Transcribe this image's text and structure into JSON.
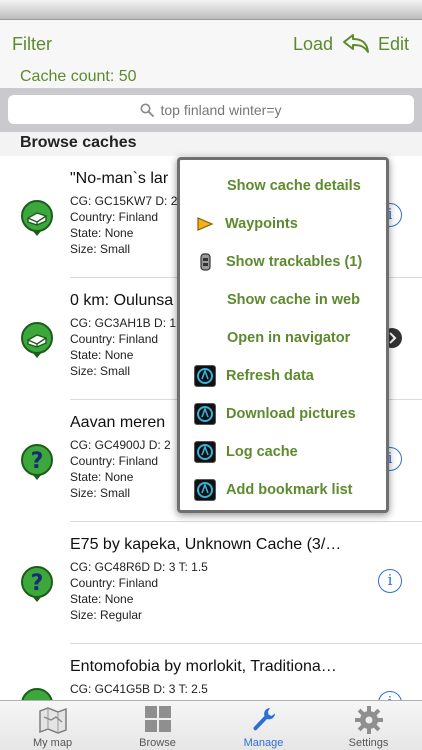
{
  "nav": {
    "filter": "Filter",
    "load": "Load",
    "edit": "Edit",
    "cache_count": "Cache count: 50"
  },
  "search": {
    "value": "top finland winter=y"
  },
  "section": {
    "title": "Browse caches"
  },
  "caches": [
    {
      "title": "\"No-man`s lar",
      "cg": "CG: GC15KW7 D: 2",
      "country": "Country: Finland",
      "state": "State: None",
      "size": "Size: Small",
      "icon": "traditional-cache-icon",
      "accessory": "info"
    },
    {
      "title": "0 km: Oulunsa",
      "cg": "CG: GC3AH1B D: 1",
      "country": "Country: Finland",
      "state": "State: None",
      "size": "Size: Small",
      "icon": "traditional-cache-icon",
      "accessory": "disclosure"
    },
    {
      "title": "Aavan meren",
      "cg": "CG: GC4900J D: 2",
      "country": "Country: Finland",
      "state": "State: None",
      "size": "Size: Small",
      "icon": "unknown-cache-icon",
      "accessory": "info"
    },
    {
      "title": "E75 by kapeka, Unknown Cache (3/…",
      "cg": "CG: GC48R6D D: 3 T: 1.5",
      "country": "Country: Finland",
      "state": "State: None",
      "size": "Size: Regular",
      "icon": "unknown-cache-icon",
      "accessory": "info"
    },
    {
      "title": "Entomofobia by morlokit, Traditiona…",
      "cg": "CG: GC41G5B D: 3 T: 2.5",
      "country": "",
      "state": "",
      "size": "",
      "icon": "traditional-cache-icon",
      "accessory": "info"
    }
  ],
  "menu": [
    {
      "label": "Show cache details",
      "icon": ""
    },
    {
      "label": "Waypoints",
      "icon": "flag-icon"
    },
    {
      "label": "Show trackables (1)",
      "icon": "trackable-icon"
    },
    {
      "label": "Show cache in web",
      "icon": ""
    },
    {
      "label": "Open in navigator",
      "icon": ""
    },
    {
      "label": "Refresh data",
      "icon": "app-icon"
    },
    {
      "label": "Download pictures",
      "icon": "app-icon"
    },
    {
      "label": "Log cache",
      "icon": "app-icon"
    },
    {
      "label": "Add bookmark list",
      "icon": "app-icon"
    }
  ],
  "tabs": [
    {
      "label": "My map",
      "icon": "map-icon",
      "active": false
    },
    {
      "label": "Browse",
      "icon": "grid-icon",
      "active": false
    },
    {
      "label": "Manage",
      "icon": "wrench-icon",
      "active": true
    },
    {
      "label": "Settings",
      "icon": "gear-icon",
      "active": false
    }
  ],
  "colors": {
    "accent": "#5d8a2e",
    "tab_active": "#2d6fd6",
    "info_blue": "#2d6fd6"
  }
}
